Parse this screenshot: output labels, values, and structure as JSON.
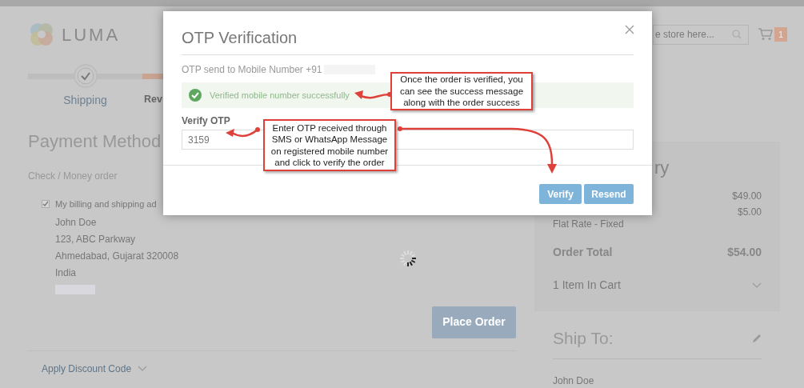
{
  "header": {
    "logo_text": "LUMA",
    "search": {
      "placeholder": "e store here..."
    },
    "cart_count": "1"
  },
  "progress": {
    "steps": [
      {
        "label": "Shipping",
        "current": false
      },
      {
        "label": "Rev",
        "current": true
      }
    ]
  },
  "payment": {
    "title": "Payment Method",
    "method": "Check / Money order",
    "same_address": {
      "label": "My billing and shipping ad",
      "checked": true
    },
    "address": [
      "John Doe",
      "123, ABC Parkway",
      "Ahmedabad, Gujarat 320008",
      "India"
    ],
    "place_order": "Place Order",
    "discount": {
      "label": "Apply Discount Code",
      "expanded": false
    }
  },
  "summary": {
    "title": "ry",
    "rows": [
      {
        "value": "$49.00"
      },
      {
        "sublabel": "Flat Rate - Fixed",
        "value": "$5.00"
      }
    ],
    "total": {
      "label": "Order Total",
      "value": "$54.00"
    },
    "items": {
      "label": "1 Item In Cart",
      "expanded": false
    }
  },
  "ship_to": {
    "title": "Ship To:",
    "lines": [
      "John Doe"
    ]
  },
  "modal": {
    "title": "OTP Verification",
    "sent_to": "OTP send to Mobile Number +91",
    "message": "Verified mobile number successfully",
    "field_label": "Verify OTP",
    "value": "3159",
    "buttons": [
      "Verify",
      "Resend"
    ]
  },
  "callouts": [
    {
      "text": "Once the order is verified, you can see the success message along with the order success"
    },
    {
      "text": "Enter OTP received through SMS or WhatsApp Message on registered mobile number and click to verify the order"
    }
  ]
}
